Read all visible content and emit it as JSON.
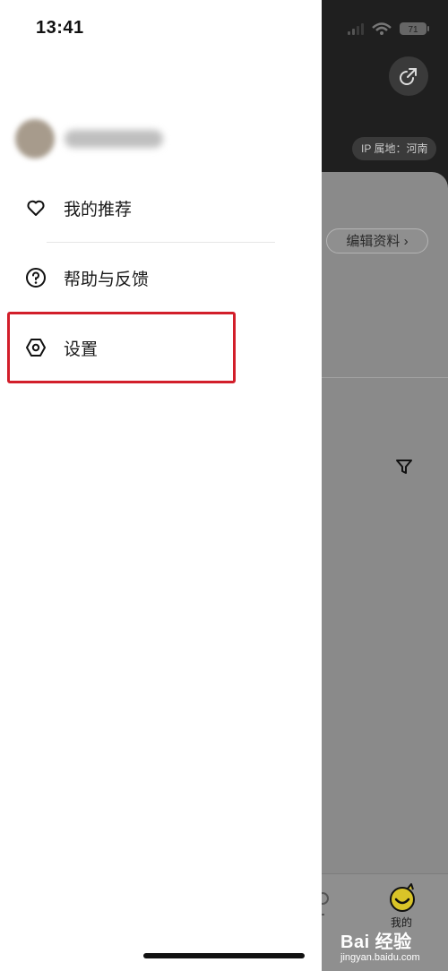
{
  "status_bar": {
    "time": "13:41",
    "battery": "71"
  },
  "profile": {
    "ip_location": "IP 属地：河南",
    "edit_profile": "编辑资料 ›"
  },
  "drawer": {
    "menu_items": [
      {
        "label": "我的推荐",
        "icon": "heart-icon"
      },
      {
        "label": "帮助与反馈",
        "icon": "help-icon"
      },
      {
        "label": "设置",
        "icon": "settings-icon"
      }
    ],
    "highlight_color": "#d21e2a"
  },
  "tab_bar": {
    "mine_label": "我的"
  },
  "watermark": {
    "brand": "Bai 经验",
    "url": "jingyan.baidu.com"
  }
}
